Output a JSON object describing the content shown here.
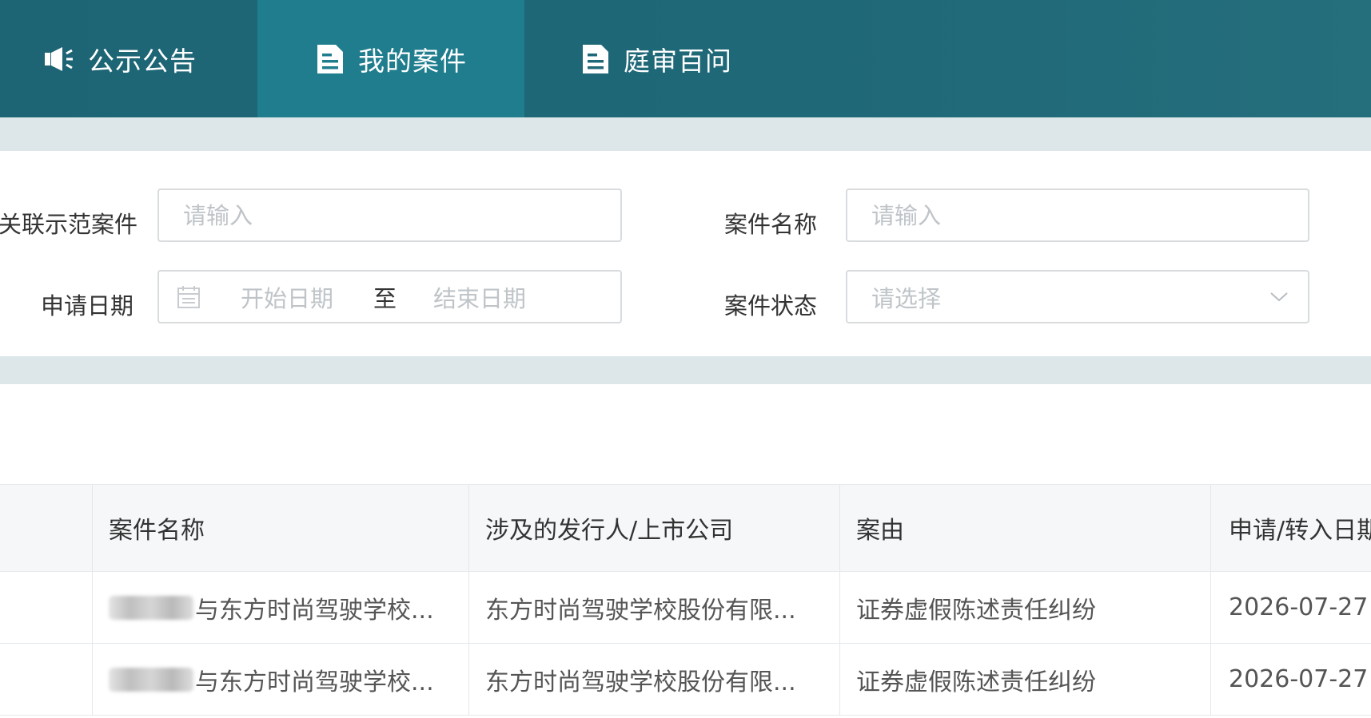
{
  "nav": {
    "tabs": [
      {
        "label": "公示公告",
        "icon": "megaphone-icon",
        "active": false
      },
      {
        "label": "我的案件",
        "icon": "document-icon",
        "active": true
      },
      {
        "label": "庭审百问",
        "icon": "document-icon",
        "active": false
      }
    ]
  },
  "filters": {
    "related_case": {
      "label": "关联示范案件",
      "placeholder": "请输入"
    },
    "case_name": {
      "label": "案件名称",
      "placeholder": "请输入"
    },
    "apply_date": {
      "label": "申请日期",
      "start_placeholder": "开始日期",
      "separator": "至",
      "end_placeholder": "结束日期"
    },
    "case_status": {
      "label": "案件状态",
      "placeholder": "请选择"
    }
  },
  "table": {
    "columns": [
      "",
      "案件名称",
      "涉及的发行人/上市公司",
      "案由",
      "申请/转入日期"
    ],
    "rows": [
      {
        "name_suffix": "与东方时尚驾驶学校...",
        "company": "东方时尚驾驶学校股份有限...",
        "cause": "证券虚假陈述责任纠纷",
        "date": "2026-07-27"
      },
      {
        "name_suffix": "与东方时尚驾驶学校...",
        "company": "东方时尚驾驶学校股份有限...",
        "cause": "证券虚假陈述责任纠纷",
        "date": "2026-07-27"
      }
    ]
  },
  "colors": {
    "nav_bg": "#1d6574",
    "nav_active": "#1f7d8e",
    "page_bg": "#dde7e9"
  }
}
